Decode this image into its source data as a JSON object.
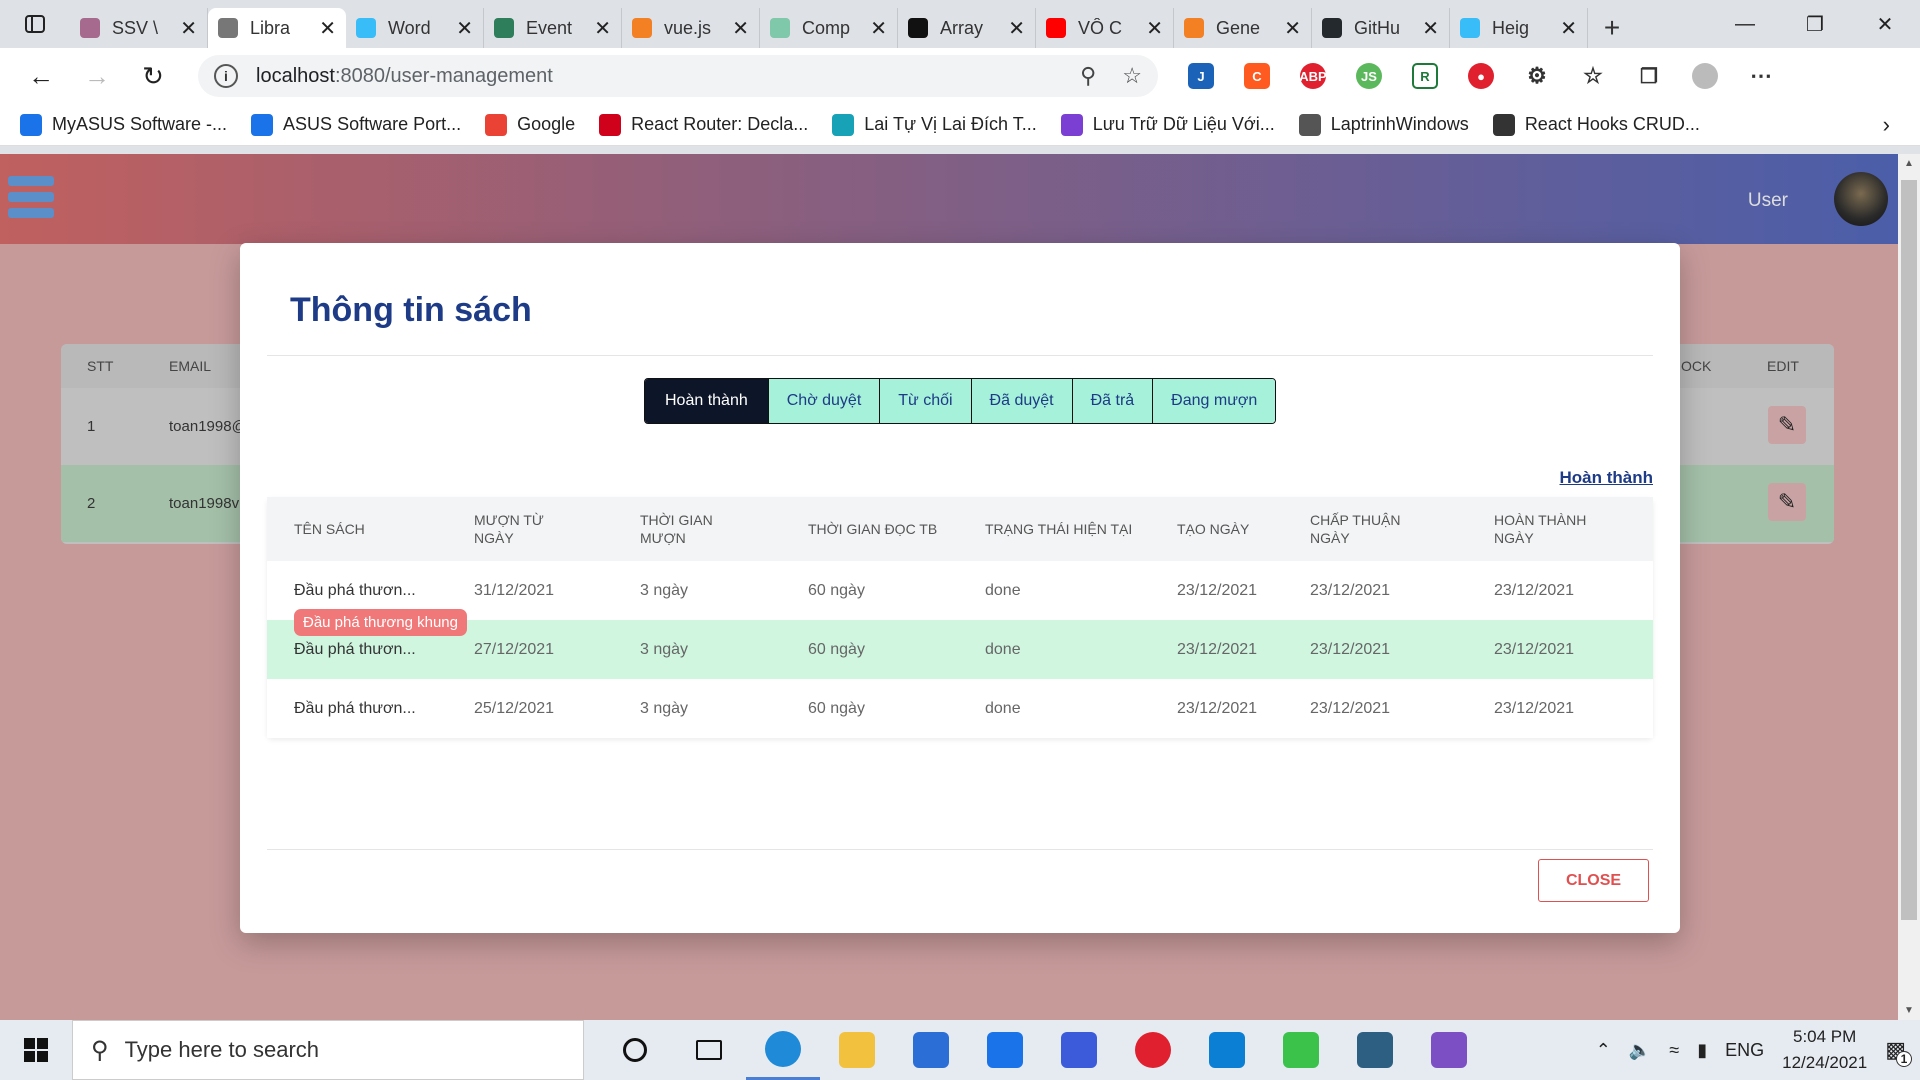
{
  "browser": {
    "tabs": [
      {
        "title": "SSV \\",
        "color": "#a56a8e"
      },
      {
        "title": "Libra",
        "color": "#777777",
        "active": true
      },
      {
        "title": "Word",
        "color": "#38bdf8"
      },
      {
        "title": "Event",
        "color": "#2e7d5b"
      },
      {
        "title": "vue.js",
        "color": "#f48024"
      },
      {
        "title": "Comp",
        "color": "#7fc8a9"
      },
      {
        "title": "Array",
        "color": "#111111"
      },
      {
        "title": "VÔ C",
        "color": "#ff0000"
      },
      {
        "title": "Gene",
        "color": "#f48024"
      },
      {
        "title": "GitHu",
        "color": "#24292e"
      },
      {
        "title": "Heig",
        "color": "#38bdf8"
      }
    ],
    "url_host": "localhost",
    "url_path": ":8080/user-management",
    "bookmarks": [
      {
        "label": "MyASUS Software -...",
        "color": "#1a73e8"
      },
      {
        "label": "ASUS Software Port...",
        "color": "#1a73e8"
      },
      {
        "label": "Google",
        "color": "#ea4335"
      },
      {
        "label": "React Router: Decla...",
        "color": "#d0021b"
      },
      {
        "label": "Lai Tự Vị Lai Đích T...",
        "color": "#17a2b8"
      },
      {
        "label": "Lưu Trữ Dữ Liệu Với...",
        "color": "#7b3fd4"
      },
      {
        "label": "LaptrinhWindows",
        "color": "#555555"
      },
      {
        "label": "React Hooks CRUD...",
        "color": "#333333"
      }
    ]
  },
  "app": {
    "user_label": "User",
    "bg_table": {
      "headers": [
        "STT",
        "EMAIL",
        "OCK",
        "EDIT"
      ],
      "rows": [
        {
          "stt": "1",
          "email": "toan1998@"
        },
        {
          "stt": "2",
          "email": "toan1998v"
        }
      ]
    }
  },
  "modal": {
    "title": "Thông tin sách",
    "segments": [
      "Hoàn thành",
      "Chờ duyệt",
      "Từ chối",
      "Đã duyệt",
      "Đã trả",
      "Đang mượn"
    ],
    "active_segment": "Hoàn thành",
    "status_link": "Hoàn thành",
    "columns": [
      "TÊN SÁCH",
      "MƯỢN TỪ NGÀY",
      "THỜI GIAN MƯỢN",
      "THỜI GIAN ĐỌC TB",
      "TRẠNG THÁI HIỆN TẠI",
      "TẠO NGÀY",
      "CHẤP THUẬN NGÀY",
      "HOÀN THÀNH NGÀY"
    ],
    "rows": [
      [
        "Đầu phá thươn...",
        "31/12/2021",
        "3 ngày",
        "60 ngày",
        "done",
        "23/12/2021",
        "23/12/2021",
        "23/12/2021"
      ],
      [
        "Đầu phá thươn...",
        "27/12/2021",
        "3 ngày",
        "60 ngày",
        "done",
        "23/12/2021",
        "23/12/2021",
        "23/12/2021"
      ],
      [
        "Đầu phá thươn...",
        "25/12/2021",
        "3 ngày",
        "60 ngày",
        "done",
        "23/12/2021",
        "23/12/2021",
        "23/12/2021"
      ]
    ],
    "tooltip": "Đầu phá thương khung",
    "close_label": "CLOSE"
  },
  "taskbar": {
    "search_placeholder": "Type here to search",
    "time": "5:04 PM",
    "date": "12/24/2021",
    "lang": "ENG",
    "notification_count": "1",
    "apps": [
      {
        "name": "edge",
        "color": "#1f8ad8"
      },
      {
        "name": "file-explorer",
        "color": "#f2c23e"
      },
      {
        "name": "store",
        "color": "#2b6fd6"
      },
      {
        "name": "mail",
        "color": "#1a73e8"
      },
      {
        "name": "azure-studio",
        "color": "#3b5bdb"
      },
      {
        "name": "opera",
        "color": "#e0202e"
      },
      {
        "name": "vscode",
        "color": "#0b7fd4"
      },
      {
        "name": "line",
        "color": "#3ac24a"
      },
      {
        "name": "mysql-workbench",
        "color": "#2d5f82"
      },
      {
        "name": "github-desktop",
        "color": "#7c4fc4"
      }
    ]
  }
}
